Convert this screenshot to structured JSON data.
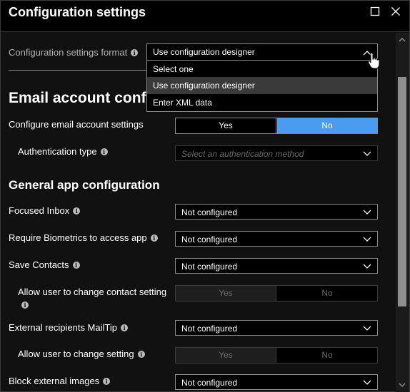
{
  "header": {
    "title": "Configuration settings"
  },
  "format": {
    "label": "Configuration settings format",
    "selected": "Use configuration designer",
    "options": [
      "Select one",
      "Use configuration designer",
      "Enter XML data"
    ]
  },
  "email": {
    "section_title": "Email account confi",
    "configure_label": "Configure email account settings",
    "yes": "Yes",
    "no": "No",
    "auth_label": "Authentication type",
    "auth_placeholder": "Select an authentication method"
  },
  "general": {
    "section_title": "General app configuration",
    "focused_inbox_label": "Focused Inbox",
    "focused_inbox_value": "Not configured",
    "biometrics_label": "Require Biometrics to access app",
    "biometrics_value": "Not configured",
    "save_contacts_label": "Save Contacts",
    "save_contacts_value": "Not configured",
    "allow_contact_label": "Allow user to change contact setting",
    "yes": "Yes",
    "no": "No",
    "mailtip_label": "External recipients MailTip",
    "mailtip_value": "Not configured",
    "allow_setting_label": "Allow user to change setting",
    "block_images_label": "Block external images",
    "block_images_value": "Not configured"
  },
  "colors": {
    "accent": "#4a9cf0",
    "background": "#111111"
  },
  "icons": {
    "info": "i"
  }
}
